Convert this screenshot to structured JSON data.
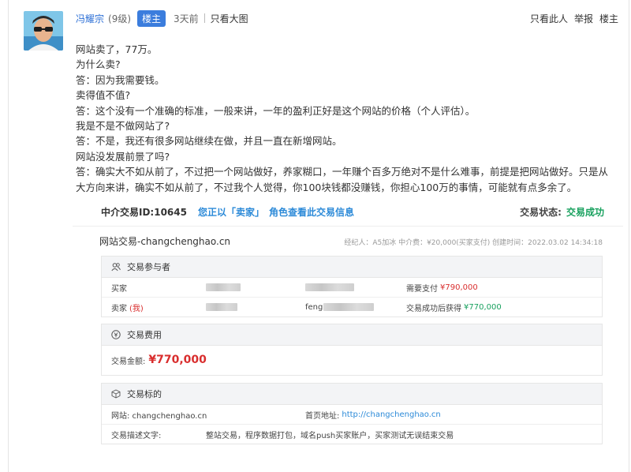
{
  "header": {
    "username": "冯耀宗",
    "level": "(9级)",
    "badge": "楼主",
    "time": "3天前",
    "only_pics": "只看大图",
    "actions": [
      "只看此人",
      "举报",
      "楼主"
    ]
  },
  "post": {
    "lines": [
      "网站卖了，77万。",
      "为什么卖?",
      "答：因为我需要钱。",
      "卖得值不值?",
      "答：这个没有一个准确的标准，一般来讲，一年的盈利正好是这个网站的价格（个人评估）。",
      "我是不是不做网站了?",
      "答：不是，我还有很多网站继续在做，并且一直在新增网站。",
      "网站没发展前景了吗?",
      "答：确实大不如从前了，不过把一个网站做好，养家糊口，一年赚个百多万绝对不是什么难事，前提是把网站做好。只是从",
      "大方向来讲，确实不如从前了，不过我个人觉得，你100块钱都没赚钱，你担心100万的事情，可能就有点多余了。"
    ]
  },
  "trade": {
    "id_text": "中介交易ID:10645",
    "role_text": "您正以「卖家」",
    "role_suffix": "角色查看此交易信息",
    "state_label": "交易状态:",
    "state_value": "交易成功",
    "site_title": "网站交易-changchenghao.cn",
    "meta": "经纪人：A5加冰   中介费：¥20,000(买家支付)   创建时间：2022.03.02 14:34:18",
    "participants": {
      "title": "交易参与者",
      "buyer_label": "买家",
      "seller_label": "卖家",
      "seller_me": "(我)",
      "seller_name_prefix": "feng",
      "need_pay_label": "需要支付",
      "need_pay_value": "¥790,000",
      "receive_label": "交易成功后获得",
      "receive_value": "¥770,000"
    },
    "fees": {
      "title": "交易费用",
      "amount_label": "交易金额:",
      "amount_value": "¥770,000"
    },
    "subject": {
      "title": "交易标的",
      "site_label": "网站: changchenghao.cn",
      "home_label": "首页地址:",
      "home_url": "http://changchenghao.cn",
      "desc_label": "交易描述文字:",
      "desc_value": "整站交易，程序数据打包，域名push买家账户，买家测试无误结束交易"
    },
    "colors": {
      "accent": "#3b7ddd",
      "success": "#19a15f",
      "price": "#d92e2e"
    }
  }
}
